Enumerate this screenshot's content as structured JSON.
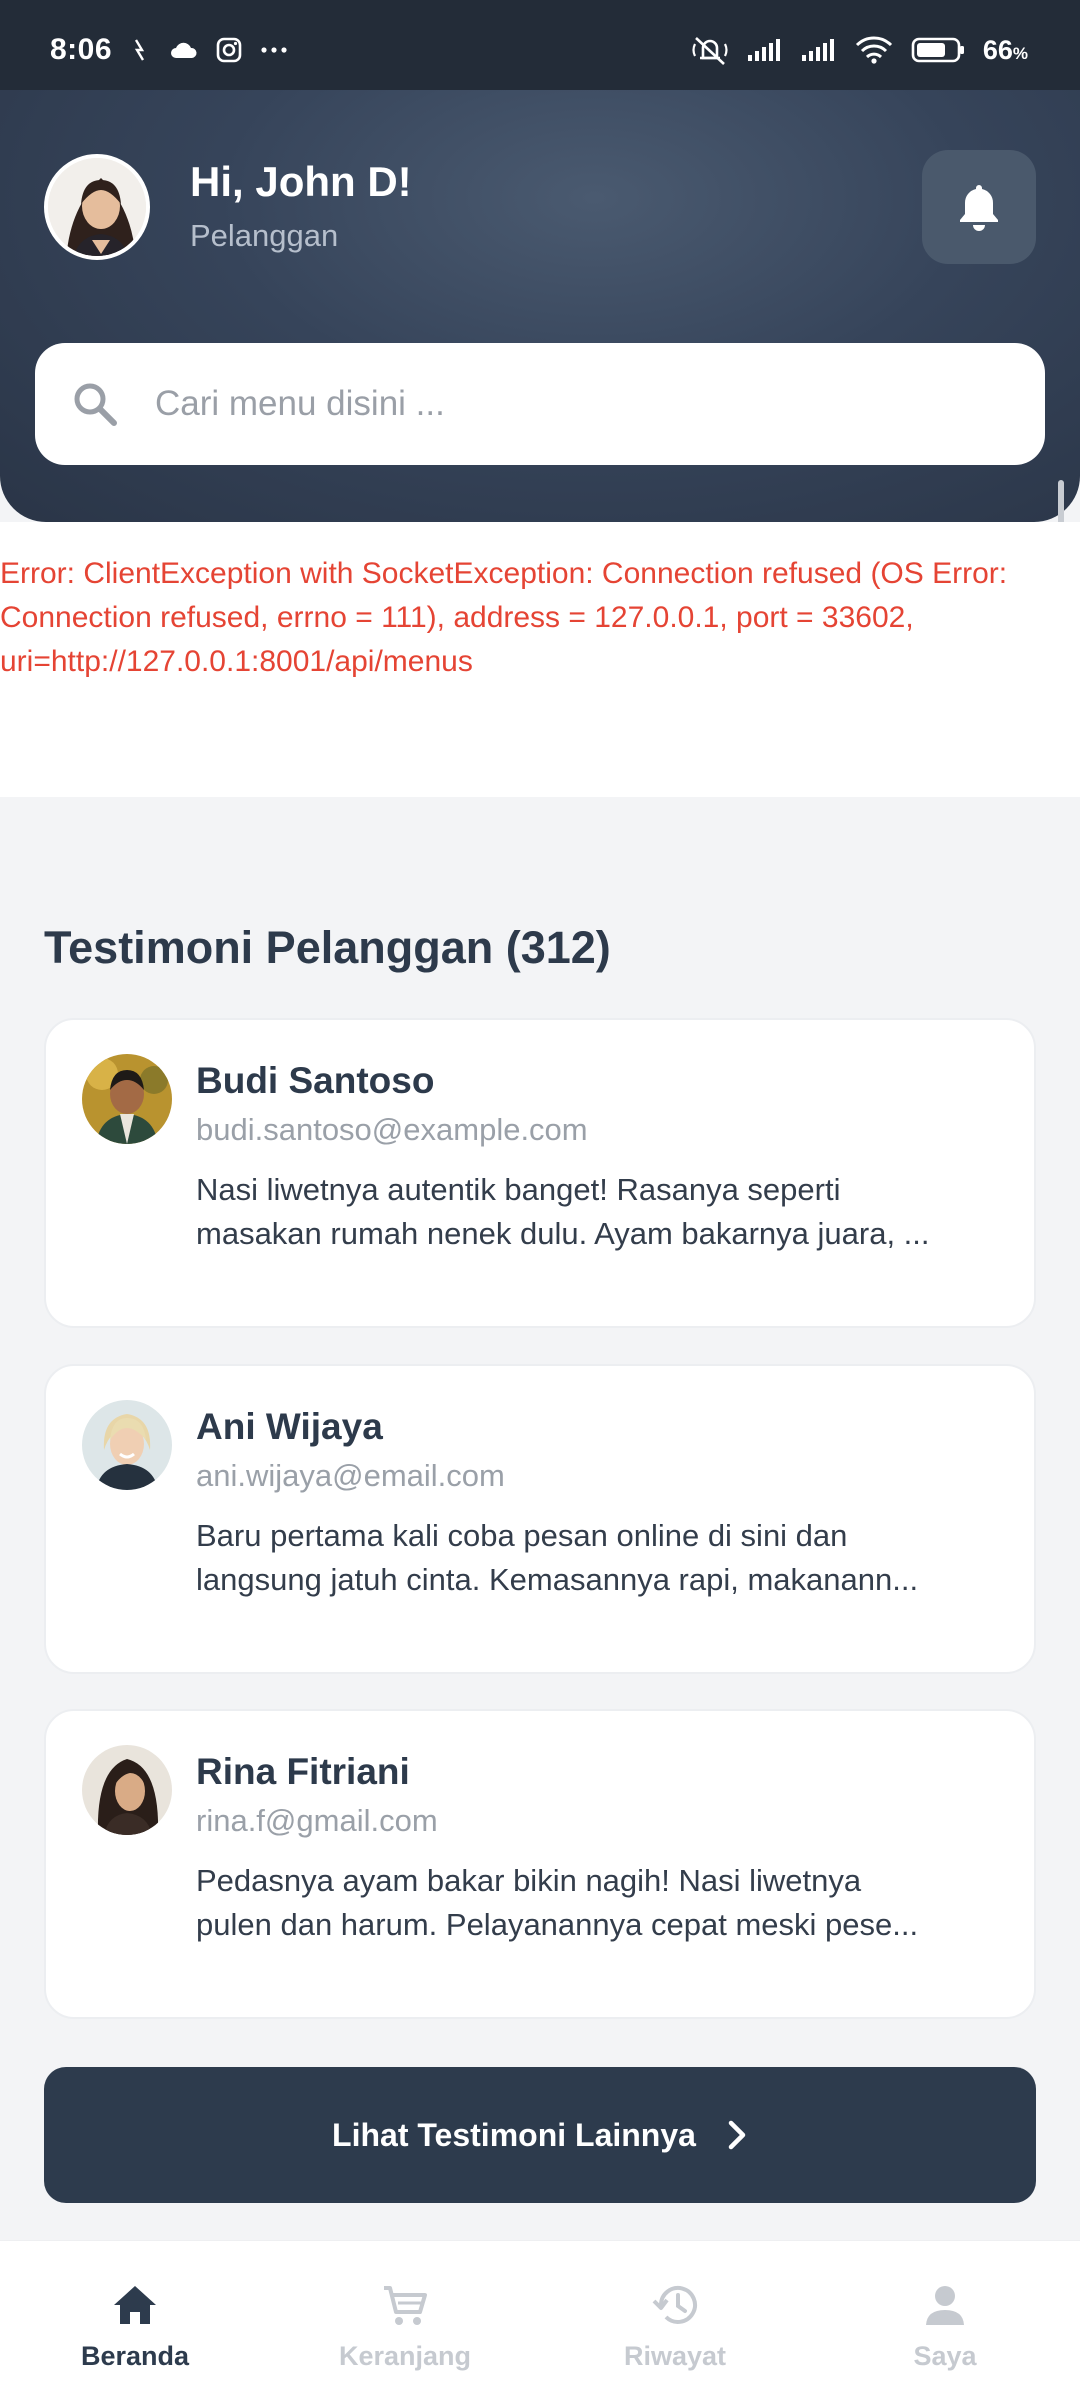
{
  "status_bar": {
    "time": "8:06",
    "battery_percent": "66",
    "battery_unit": "%",
    "icons": [
      "usb-debug-icon",
      "cloud-icon",
      "instagram-icon",
      "more-dots-icon",
      "mute-icon",
      "signal-icon",
      "signal-icon",
      "wifi-icon",
      "battery-icon"
    ]
  },
  "header": {
    "greeting": "Hi, John D!",
    "role": "Pelanggan",
    "search_placeholder": "Cari menu disini ..."
  },
  "error": {
    "message": "Error: ClientException with SocketException: Connection refused (OS Error: Connection refused, errno = 111), address = 127.0.0.1, port = 33602, uri=http://127.0.0.1:8001/api/menus"
  },
  "testimonials": {
    "title": "Testimoni Pelanggan (312)",
    "items": [
      {
        "name": "Budi Santoso",
        "email": "budi.santoso@example.com",
        "line1": "Nasi liwetnya autentik banget! Rasanya seperti",
        "line2": "masakan rumah nenek dulu. Ayam bakarnya juara, ..."
      },
      {
        "name": "Ani Wijaya",
        "email": "ani.wijaya@email.com",
        "line1": "Baru pertama kali coba pesan online di sini dan",
        "line2": "langsung jatuh cinta. Kemasannya rapi, makanann..."
      },
      {
        "name": "Rina Fitriani",
        "email": "rina.f@gmail.com",
        "line1": "Pedasnya ayam bakar bikin nagih! Nasi liwetnya",
        "line2": "pulen dan harum. Pelayanannya cepat meski pese..."
      }
    ],
    "more_label": "Lihat Testimoni Lainnya"
  },
  "bottom_nav": {
    "items": [
      {
        "label": "Beranda",
        "icon": "home-icon",
        "active": true
      },
      {
        "label": "Keranjang",
        "icon": "cart-icon",
        "active": false
      },
      {
        "label": "Riwayat",
        "icon": "history-icon",
        "active": false
      },
      {
        "label": "Saya",
        "icon": "person-icon",
        "active": false
      }
    ]
  },
  "colors": {
    "header": "#36445a",
    "error": "#e54434",
    "primary": "#2d3b4d",
    "inactive": "#c6cad0"
  }
}
